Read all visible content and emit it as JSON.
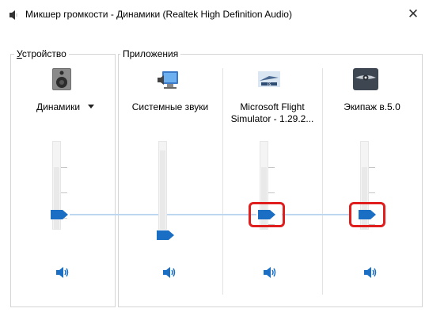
{
  "window": {
    "title": "Микшер громкости - Динамики (Realtek High Definition Audio)",
    "close_glyph": "✕"
  },
  "device_group": {
    "label_underlined": "У",
    "label_rest": "стройство",
    "device_name": "Динамики",
    "volume_percent": 35,
    "icon": "speaker-device-icon",
    "mute_icon": "speaker-icon"
  },
  "apps_group": {
    "label": "Приложения",
    "apps": [
      {
        "name": "Системные звуки",
        "name_line2": "",
        "volume_percent": 10,
        "icon": "system-sounds-icon",
        "highlighted": false
      },
      {
        "name": "Microsoft Flight",
        "name_line2": "Simulator - 1.29.2...",
        "volume_percent": 35,
        "icon": "flight-simulator-icon",
        "highlighted": true
      },
      {
        "name": "Экипаж в.5.0",
        "name_line2": "",
        "volume_percent": 35,
        "icon": "crew-app-icon",
        "highlighted": true
      }
    ]
  },
  "colors": {
    "thumb": "#1a6fc4",
    "highlight": "#e01e1e",
    "peak_line": "#bcd7ef"
  }
}
